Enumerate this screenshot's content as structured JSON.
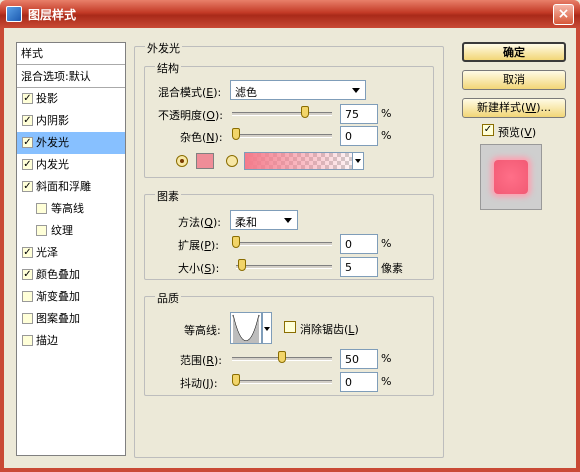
{
  "window": {
    "title": "图层样式",
    "close_label": "×"
  },
  "sidebar": {
    "header": "样式",
    "blend_default": "混合选项:默认",
    "items": [
      {
        "label": "投影",
        "checked": true
      },
      {
        "label": "内阴影",
        "checked": true
      },
      {
        "label": "外发光",
        "checked": true,
        "selected": true
      },
      {
        "label": "内发光",
        "checked": true
      },
      {
        "label": "斜面和浮雕",
        "checked": true
      },
      {
        "label": "等高线",
        "checked": false,
        "indent": true
      },
      {
        "label": "纹理",
        "checked": false,
        "indent": true
      },
      {
        "label": "光泽",
        "checked": true
      },
      {
        "label": "颜色叠加",
        "checked": true
      },
      {
        "label": "渐变叠加",
        "checked": false
      },
      {
        "label": "图案叠加",
        "checked": false
      },
      {
        "label": "描边",
        "checked": false
      }
    ]
  },
  "panel": {
    "title": "外发光",
    "structure": {
      "title": "结构",
      "blend_mode_label": "混合模式(",
      "blend_mode_key": "E",
      "blend_mode_suffix": "):",
      "blend_mode_value": "滤色",
      "opacity_label": "不透明度(",
      "opacity_key": "O",
      "opacity_suffix": "):",
      "opacity_value": "75",
      "opacity_unit": "%",
      "opacity_level": 0.75,
      "noise_label": "杂色(",
      "noise_key": "N",
      "noise_suffix": "):",
      "noise_value": "0",
      "noise_unit": "%",
      "noise_level": 0.0,
      "color_hex": "#ef8d98",
      "gradient_from": "#f47b8b"
    },
    "elements": {
      "title": "图素",
      "method_label": "方法(",
      "method_key": "Q",
      "method_suffix": "):",
      "method_value": "柔和",
      "spread_label": "扩展(",
      "spread_key": "P",
      "spread_suffix": "):",
      "spread_value": "0",
      "spread_unit": "%",
      "spread_level": 0.0,
      "size_label": "大小(",
      "size_key": "S",
      "size_suffix": "):",
      "size_value": "5",
      "size_unit": "像素",
      "size_level": 0.02
    },
    "quality": {
      "title": "品质",
      "contour_label": "等高线:",
      "antialias_label": "消除锯齿(",
      "antialias_key": "L",
      "antialias_suffix": ")",
      "antialias_checked": false,
      "range_label": "范围(",
      "range_key": "R",
      "range_suffix": "):",
      "range_value": "50",
      "range_unit": "%",
      "range_level": 0.5,
      "jitter_label": "抖动(",
      "jitter_key": "J",
      "jitter_suffix": "):",
      "jitter_value": "0",
      "jitter_unit": "%",
      "jitter_level": 0.0
    }
  },
  "buttons": {
    "ok": "确定",
    "cancel": "取消",
    "new_style": "新建样式(",
    "new_style_key": "W",
    "new_style_suffix": ")...",
    "preview_label": "预览(",
    "preview_key": "V",
    "preview_suffix": ")",
    "preview_checked": true
  },
  "colors": {
    "accent": "#87c0ff",
    "title_bar": "#c33a26",
    "preview_fill": "#f25a74"
  }
}
